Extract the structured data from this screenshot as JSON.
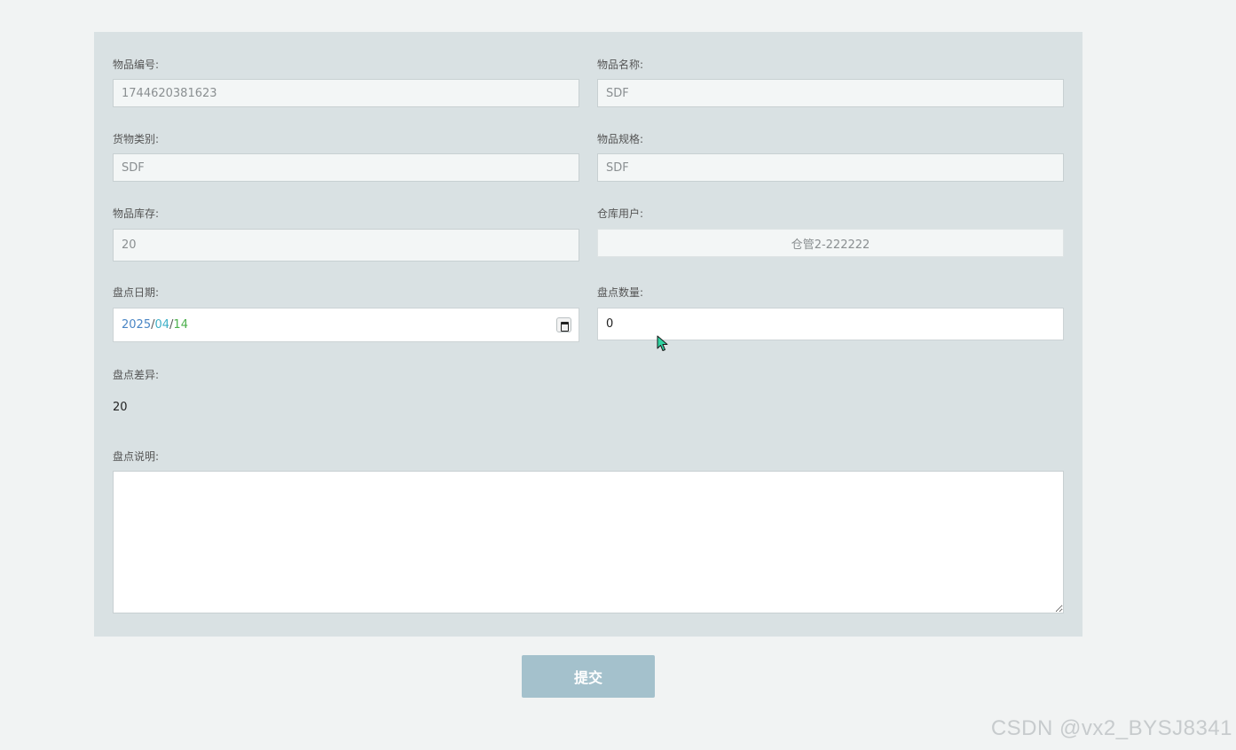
{
  "form": {
    "item_code": {
      "label": "物品编号:",
      "value": "1744620381623"
    },
    "item_name": {
      "label": "物品名称:",
      "value": "SDF"
    },
    "goods_category": {
      "label": "货物类别:",
      "value": "SDF"
    },
    "item_spec": {
      "label": "物品规格:",
      "value": "SDF"
    },
    "item_stock": {
      "label": "物品库存:",
      "value": "20"
    },
    "warehouse_user": {
      "label": "仓库用户:",
      "value": "仓管2-222222"
    },
    "check_date": {
      "label": "盘点日期:",
      "year": "2025",
      "month": "04",
      "day": "14",
      "separator": "/"
    },
    "check_quantity": {
      "label": "盘点数量:",
      "value": "0"
    },
    "check_difference": {
      "label": "盘点差异:",
      "value": "20"
    },
    "check_description": {
      "label": "盘点说明:",
      "value": ""
    }
  },
  "submit_label": "提交",
  "watermark": "CSDN @vx2_BYSJ8341",
  "colors": {
    "page_bg": "#f1f3f3",
    "panel_bg": "#d9e1e3",
    "submit_bg": "#a4c1cc",
    "cursor": "#2fd3a2"
  }
}
